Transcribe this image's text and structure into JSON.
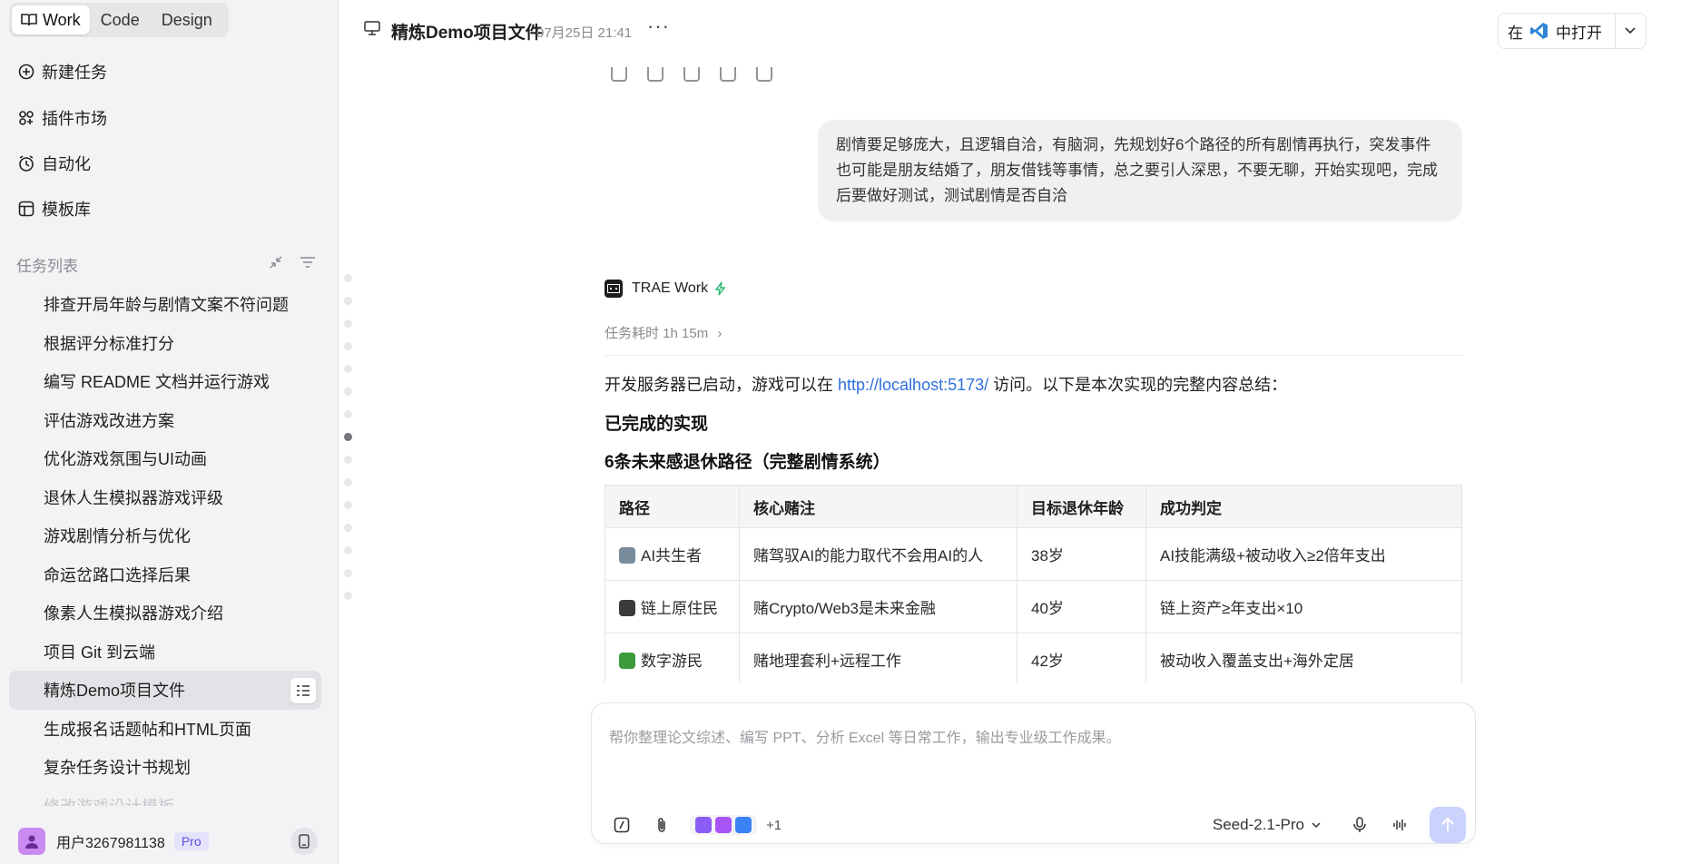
{
  "sidebar": {
    "modes": [
      "Work",
      "Code",
      "Design"
    ],
    "nav": [
      {
        "label": "新建任务",
        "icon": "new-task-icon"
      },
      {
        "label": "插件市场",
        "icon": "plugin-icon"
      },
      {
        "label": "自动化",
        "icon": "clock-icon"
      },
      {
        "label": "模板库",
        "icon": "template-icon"
      }
    ],
    "tasks_header": "任务列表",
    "tasks": [
      "排查开局年龄与剧情文案不符问题",
      "根据评分标准打分",
      "编写 README 文档并运行游戏",
      "评估游戏改进方案",
      "优化游戏氛围与UI动画",
      "退休人生模拟器游戏评级",
      "游戏剧情分析与优化",
      "命运岔路口选择后果",
      "像素人生模拟器游戏介绍",
      "项目 Git 到云端",
      "精炼Demo项目文件",
      "生成报名话题帖和HTML页面",
      "复杂任务设计书规划",
      "修改游戏设计模板"
    ],
    "active_task_index": 10,
    "user": {
      "name": "用户3267981138",
      "badge": "Pro"
    }
  },
  "topbar": {
    "title": "精炼Demo项目文件",
    "timestamp": "07月25日 21:41",
    "more": "···",
    "open_in_prefix": "在",
    "open_in_suffix": "中打开"
  },
  "conversation": {
    "user_message": "剧情要足够庞大，且逻辑自洽，有脑洞，先规划好6个路径的所有剧情再执行，突发事件也可能是朋友结婚了，朋友借钱等事情，总之要引人深思，不要无聊，开始实现吧，完成后要做好测试，测试剧情是否自洽",
    "assistant_name": "TRAE Work",
    "duration": "任务耗时 1h 15m",
    "summary_prefix": "开发服务器已启动，游戏可以在",
    "summary_link": "http://localhost:5173/",
    "summary_suffix": "访问。以下是本次实现的完整内容总结：",
    "heading1": "已完成的实现",
    "heading2": "6条未来感退休路径（完整剧情系统）",
    "table": {
      "headers": [
        "路径",
        "核心赌注",
        "目标退休年龄",
        "成功判定"
      ],
      "rows": [
        [
          "AI共生者",
          "赌驾驭AI的能力取代不会用AI的人",
          "38岁",
          "AI技能满级+被动收入≥2倍年支出"
        ],
        [
          "链上原住民",
          "赌Crypto/Web3是未来金融",
          "40岁",
          "链上资产≥年支出×10"
        ],
        [
          "数字游民",
          "赌地理套利+远程工作",
          "42岁",
          "被动收入覆盖支出+海外定居"
        ]
      ]
    }
  },
  "composer": {
    "placeholder": "帮你整理论文综述、编写 PPT、分析 Excel 等日常工作，输出专业级工作成果。",
    "plugins_more": "+1",
    "model": "Seed-2.1-Pro"
  },
  "colors": {
    "accent": "#2f6fe0",
    "send_disabled": "#c9d3fb",
    "pro_badge": "#5a4fe0"
  }
}
